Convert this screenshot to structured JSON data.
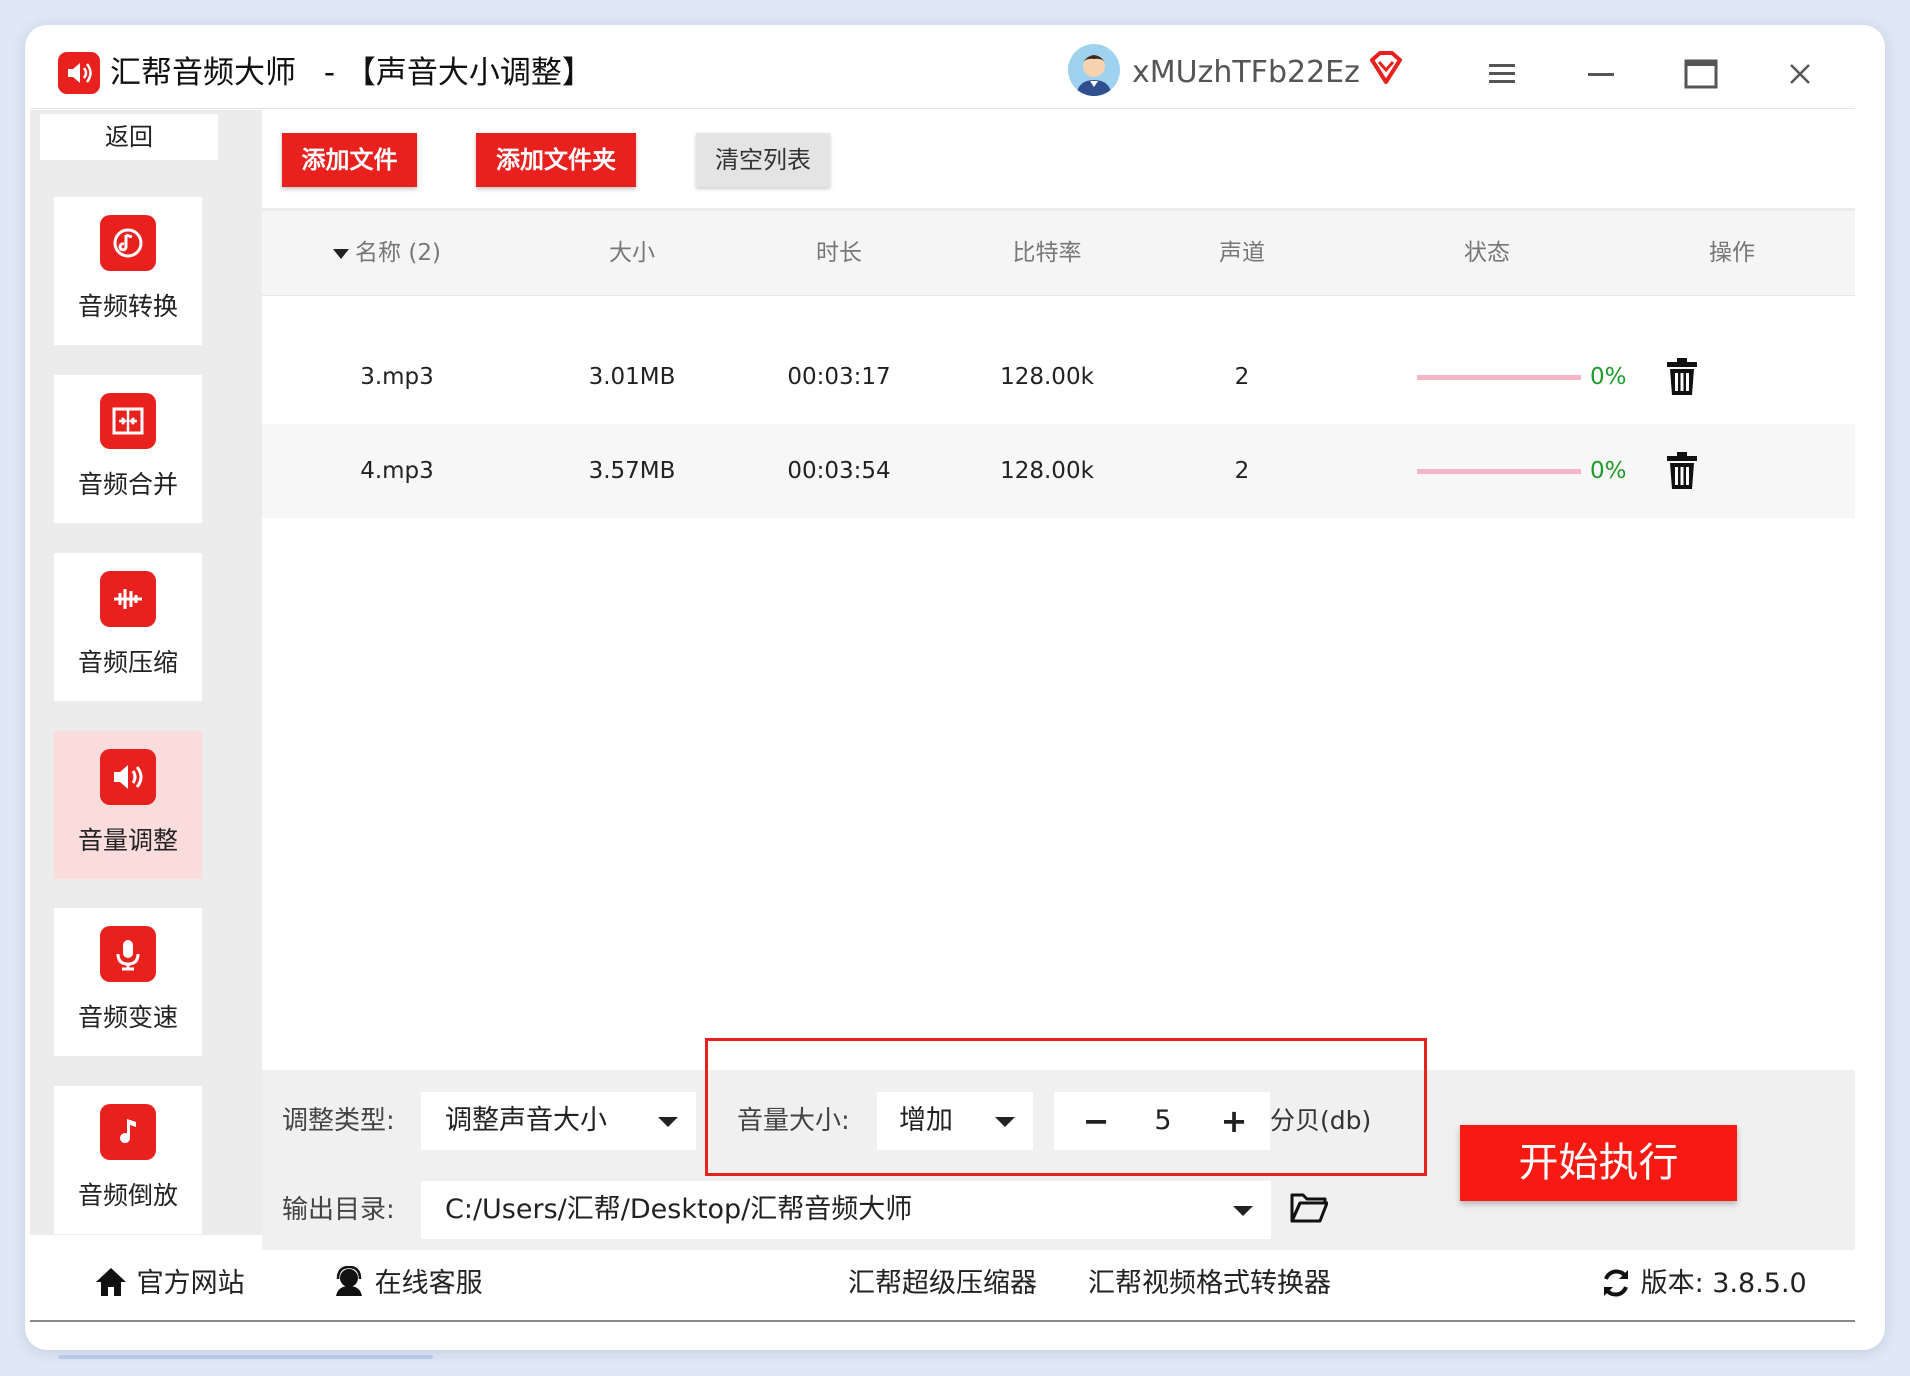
{
  "window": {
    "app_name": "汇帮音频大师",
    "title_suffix": "-  【声音大小调整】",
    "username": "xMUzhTFb22Ez"
  },
  "sidebar": {
    "back_label": "返回",
    "items": [
      {
        "label": "音频转换",
        "icon": "audio-convert-icon"
      },
      {
        "label": "音频合并",
        "icon": "audio-merge-icon"
      },
      {
        "label": "音频压缩",
        "icon": "audio-compress-icon"
      },
      {
        "label": "音量调整",
        "icon": "volume-adjust-icon",
        "active": true
      },
      {
        "label": "音频变速",
        "icon": "audio-speed-icon"
      },
      {
        "label": "音频倒放",
        "icon": "audio-reverse-icon"
      }
    ]
  },
  "toolbar": {
    "add_file": "添加文件",
    "add_folder": "添加文件夹",
    "clear_list": "清空列表"
  },
  "table": {
    "columns": [
      "名称 (2)",
      "大小",
      "时长",
      "比特率",
      "声道",
      "状态",
      "操作"
    ],
    "rows": [
      {
        "name": "3.mp3",
        "size": "3.01MB",
        "duration": "00:03:17",
        "bitrate": "128.00k",
        "channels": "2",
        "progress": "0%"
      },
      {
        "name": "4.mp3",
        "size": "3.57MB",
        "duration": "00:03:54",
        "bitrate": "128.00k",
        "channels": "2",
        "progress": "0%"
      }
    ]
  },
  "settings": {
    "adjust_type_label": "调整类型:",
    "adjust_type_value": "调整声音大小",
    "volume_label": "音量大小:",
    "volume_mode": "增加",
    "volume_value": "5",
    "unit": "分贝(db)",
    "output_label": "输出目录:",
    "output_path": "C:/Users/汇帮/Desktop/汇帮音频大师",
    "start_button": "开始执行"
  },
  "footer": {
    "website": "官方网站",
    "support": "在线客服",
    "link1": "汇帮超级压缩器",
    "link2": "汇帮视频格式转换器",
    "version": "版本:  3.8.5.0"
  },
  "colors": {
    "accent_red": "#e8201e",
    "active_bg": "#fbdcdc",
    "progress_track": "#f4b6c6",
    "percent_green": "#1e9b2a"
  }
}
